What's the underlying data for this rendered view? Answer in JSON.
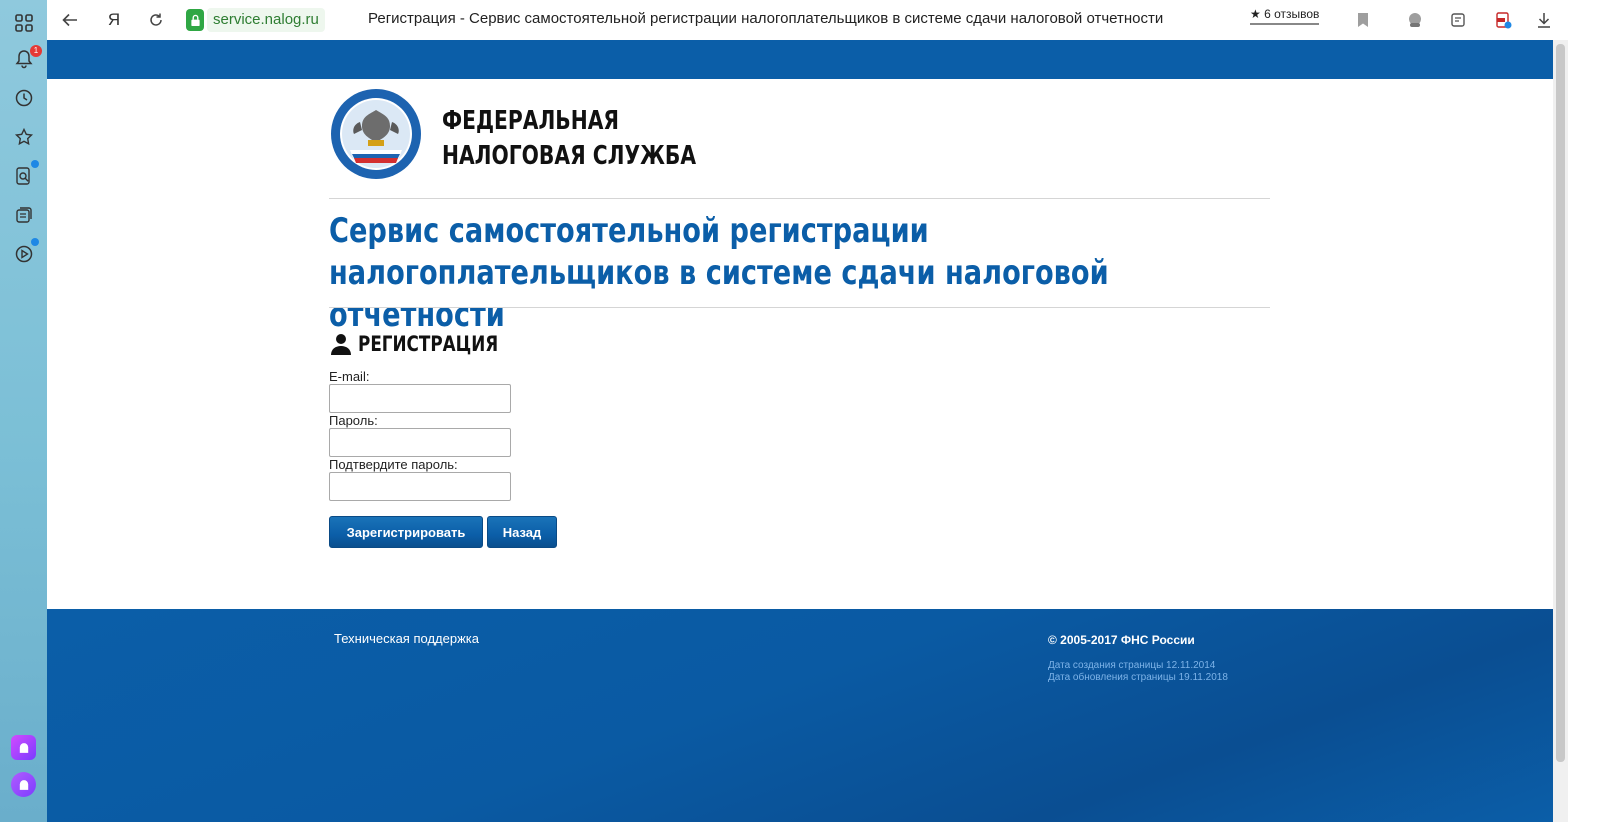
{
  "browser": {
    "url_host": "service.nalog.ru",
    "tab_title": "Регистрация - Сервис самостоятельной регистрации налогоплательщиков в системе сдачи налоговой отчетности",
    "reviews": "★ 6 отзывов",
    "yandex_glyph": "Я",
    "notification_count": "1"
  },
  "header": {
    "org_name_line1": "ФЕДЕРАЛЬНАЯ",
    "org_name_line2": "НАЛОГОВАЯ СЛУЖБА"
  },
  "main": {
    "service_title": "Сервис самостоятельной регистрации налогоплательщиков в системе сдачи налоговой отчетности",
    "section_heading": "РЕГИСТРАЦИЯ"
  },
  "form": {
    "email_label": "E-mail:",
    "email_value": "",
    "password_label": "Пароль:",
    "password_value": "",
    "confirm_label": "Подтвердите пароль:",
    "confirm_value": "",
    "register_button": "Зарегистрировать",
    "back_button": "Назад"
  },
  "footer": {
    "support_link": "Техническая поддержка",
    "copyright": "© 2005-2017 ФНС России",
    "created": "Дата создания страницы 12.11.2014",
    "updated": "Дата обновления страницы 19.11.2018"
  },
  "colors": {
    "brand_blue": "#0b5ea8",
    "lock_green": "#2fa744"
  }
}
